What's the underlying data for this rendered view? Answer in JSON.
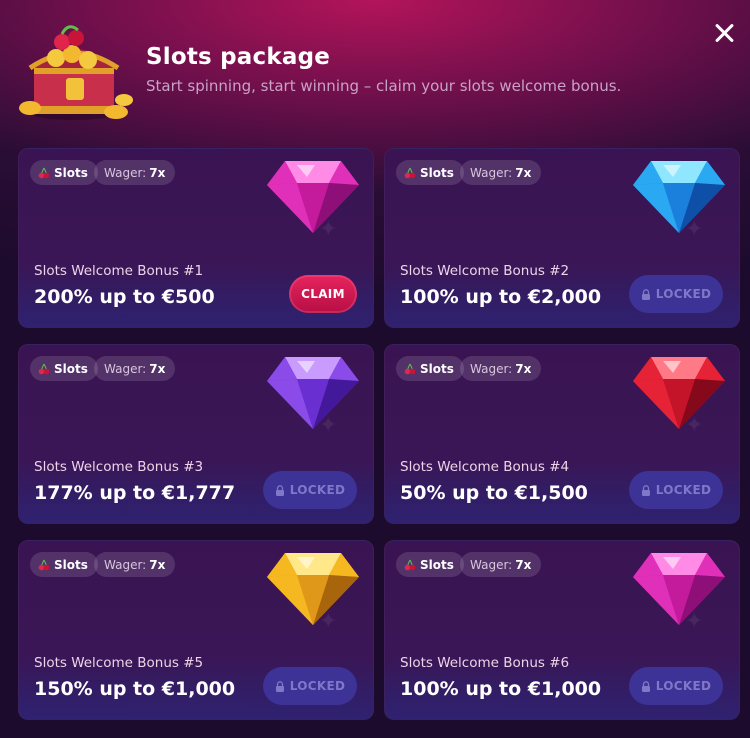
{
  "header": {
    "title": "Slots package",
    "subtitle": "Start spinning, start winning – claim your slots welcome bonus."
  },
  "colors": {
    "accent": "#d81b56",
    "locked_button": "#3d3296",
    "card_bg": "#3a1452"
  },
  "cards": [
    {
      "tag_slots": "Slots",
      "wager_label": "Wager:",
      "wager_value": "7x",
      "name": "Slots Welcome Bonus #1",
      "amount": "200% up to €500",
      "button": "CLAIM",
      "gem": "pink-gem-icon",
      "status": "claimable"
    },
    {
      "tag_slots": "Slots",
      "wager_label": "Wager:",
      "wager_value": "7x",
      "name": "Slots Welcome Bonus #2",
      "amount": "100% up to €2,000",
      "button": "LOCKED",
      "gem": "blue-gem-icon",
      "status": "locked"
    },
    {
      "tag_slots": "Slots",
      "wager_label": "Wager:",
      "wager_value": "7x",
      "name": "Slots Welcome Bonus #3",
      "amount": "177% up to €1,777",
      "button": "LOCKED",
      "gem": "purple-gem-icon",
      "status": "locked"
    },
    {
      "tag_slots": "Slots",
      "wager_label": "Wager:",
      "wager_value": "7x",
      "name": "Slots Welcome Bonus #4",
      "amount": "50% up to €1,500",
      "button": "LOCKED",
      "gem": "red-gem-icon",
      "status": "locked"
    },
    {
      "tag_slots": "Slots",
      "wager_label": "Wager:",
      "wager_value": "7x",
      "name": "Slots Welcome Bonus #5",
      "amount": "150% up to €1,000",
      "button": "LOCKED",
      "gem": "yellow-gem-icon",
      "status": "locked"
    },
    {
      "tag_slots": "Slots",
      "wager_label": "Wager:",
      "wager_value": "7x",
      "name": "Slots Welcome Bonus #6",
      "amount": "100% up to €1,000",
      "button": "LOCKED",
      "gem": "pink-gem-icon",
      "status": "locked"
    }
  ]
}
